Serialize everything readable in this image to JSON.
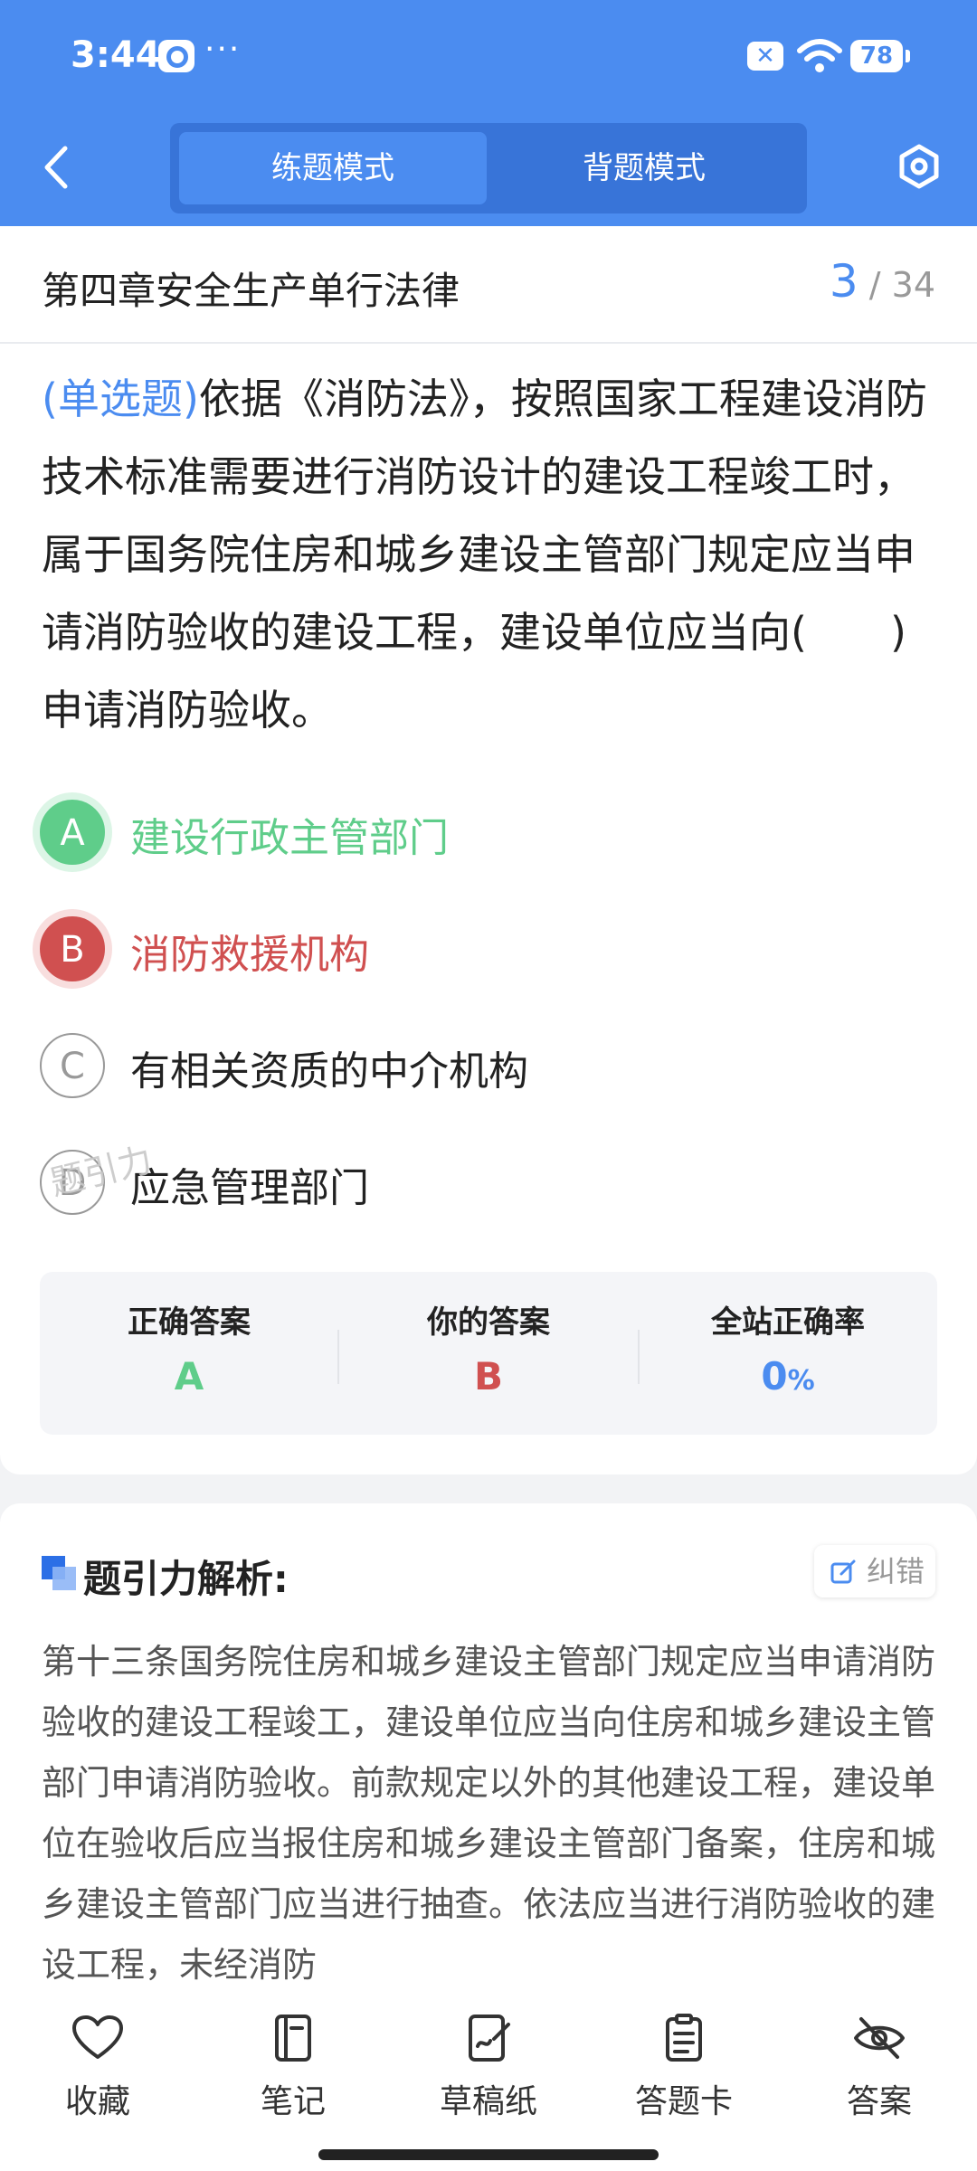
{
  "status_bar": {
    "time": "3:44",
    "dots": "···",
    "battery": "78",
    "mute_glyph": "✕"
  },
  "header": {
    "tabs": [
      {
        "label": "练题模式",
        "active": true
      },
      {
        "label": "背题模式",
        "active": false
      }
    ],
    "icons": {
      "back": "chevron-left-icon",
      "settings": "hexagon-settings-icon"
    }
  },
  "chapter": {
    "title": "第四章安全生产单行法律",
    "current": "3",
    "separator": "/",
    "total": "34"
  },
  "question": {
    "type": "(单选题)",
    "text": "依据《消防法》，按照国家工程建设消防技术标准需要进行消防设计的建设工程竣工时，属于国务院住房和城乡建设主管部门规定应当申请消防验收的建设工程，建设单位应当向(　　)申请消防验收。",
    "options": [
      {
        "letter": "A",
        "text": "建设行政主管部门",
        "state": "correct"
      },
      {
        "letter": "B",
        "text": "消防救援机构",
        "state": "wrong"
      },
      {
        "letter": "C",
        "text": "有相关资质的中介机构",
        "state": "normal"
      },
      {
        "letter": "D",
        "text": "应急管理部门",
        "state": "normal"
      }
    ],
    "watermark": "题引力"
  },
  "answer_summary": {
    "correct_label": "正确答案",
    "correct_value": "A",
    "yours_label": "你的答案",
    "yours_value": "B",
    "rate_label": "全站正确率",
    "rate_value": "0",
    "rate_unit": "%",
    "colors": {
      "correct": "#5fcd8a",
      "wrong": "#d05050",
      "rate": "#4b8cf0"
    }
  },
  "analysis": {
    "title": "题引力解析:",
    "report_label": "纠错",
    "text": "第十三条国务院住房和城乡建设主管部门规定应当申请消防验收的建设工程竣工，建设单位应当向住房和城乡建设主管部门申请消防验收。前款规定以外的其他建设工程，建设单位在验收后应当报住房和城乡建设主管部门备案，住房和城乡建设主管部门应当进行抽查。依法应当进行消防验收的建设工程，未经消防"
  },
  "bottom_bar": {
    "items": [
      {
        "label": "收藏",
        "icon": "heart-icon"
      },
      {
        "label": "笔记",
        "icon": "notebook-icon"
      },
      {
        "label": "草稿纸",
        "icon": "draft-paper-icon"
      },
      {
        "label": "答题卡",
        "icon": "answer-card-icon"
      },
      {
        "label": "答案",
        "icon": "eye-off-icon"
      }
    ]
  },
  "theme": {
    "primary": "#4b8cf0",
    "primary_dark": "#3874d8"
  }
}
